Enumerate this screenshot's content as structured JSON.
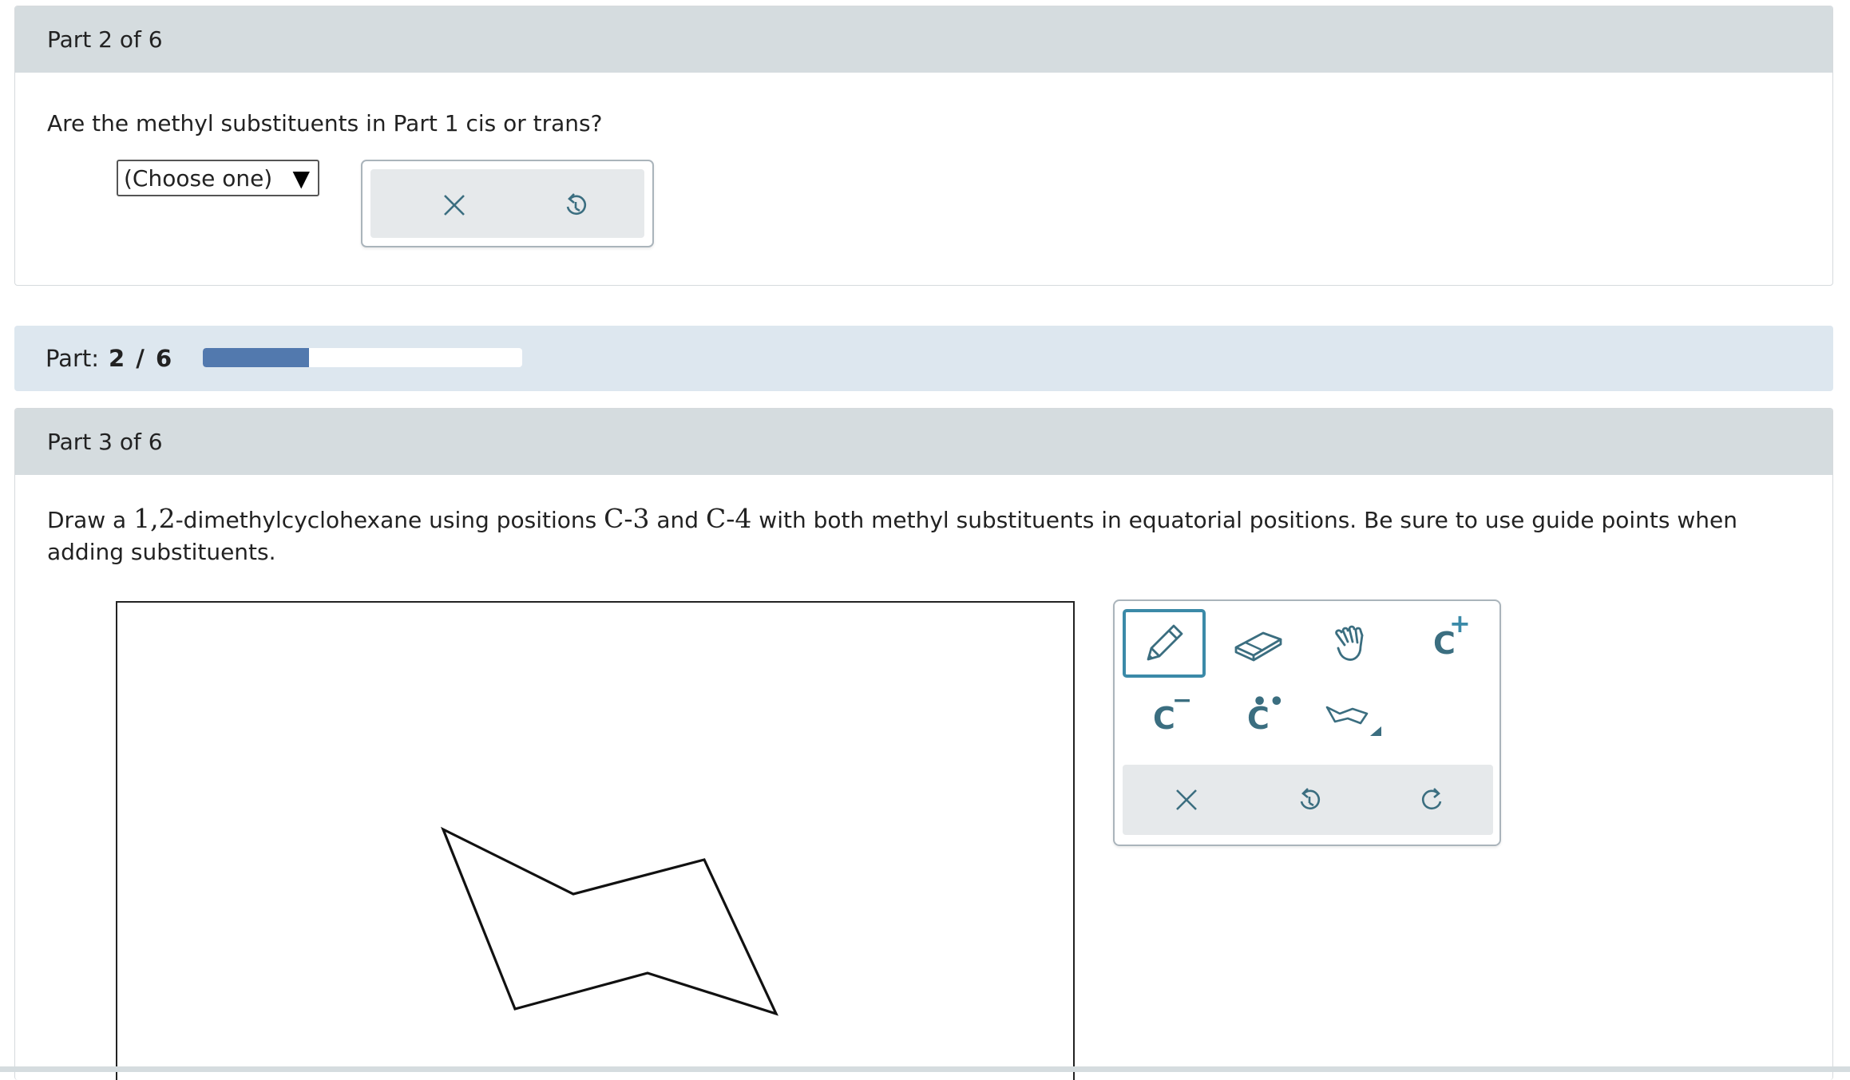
{
  "part2": {
    "header": "Part 2 of 6",
    "question": "Are the methyl substituents in Part 1 cis or trans?",
    "select_value": "(Choose one)",
    "caret": "▼"
  },
  "progress": {
    "label": "Part:",
    "value_text": "2 / 6",
    "current": 2,
    "total": 6
  },
  "part3": {
    "header": "Part 3 of 6",
    "question_parts": {
      "p1": "Draw a ",
      "m1": "1,2",
      "p2": "-dimethylcyclohexane using positions ",
      "m2": "C-3",
      "p3": " and ",
      "m3": "C-4",
      "p4": " with both methyl substituents in equatorial positions. Be sure to use guide points when adding substituents."
    }
  },
  "toolbox": {
    "tools": [
      "pencil-icon",
      "eraser-icon",
      "hand-icon",
      "carbocation-icon",
      "carbanion-icon",
      "carbene-icon",
      "cyclohexane-template-icon"
    ],
    "labels": {
      "carbocation": "C",
      "carbocation_sup": "+",
      "carbanion": "C",
      "carbanion_sup": "−",
      "carbene": "C"
    }
  },
  "colors": {
    "header_bg": "#d5dcdf",
    "progress_bg": "#dde7ef",
    "progress_fill": "#5279ae",
    "accent": "#3b8aa8",
    "icon": "#3b6e80"
  }
}
